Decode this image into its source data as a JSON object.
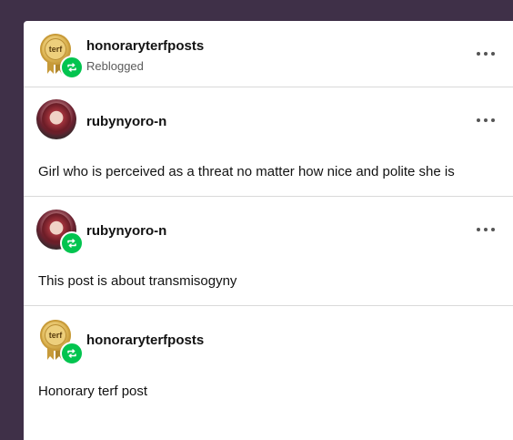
{
  "posts": [
    {
      "username": "honoraryterfposts",
      "subtitle": "Reblogged",
      "avatar_type": "seal",
      "seal_text": "terf",
      "reblog_badge": true,
      "more_icon": "ellipsis-icon"
    },
    {
      "username": "rubynyoro-n",
      "avatar_type": "photo",
      "reblog_badge": false,
      "more_icon": "ellipsis-icon",
      "body": "Girl who is perceived as a threat no matter how nice and polite she is"
    },
    {
      "username": "rubynyoro-n",
      "avatar_type": "photo",
      "reblog_badge": true,
      "more_icon": "ellipsis-icon",
      "body": "This post is about transmisogyny"
    },
    {
      "username": "honoraryterfposts",
      "avatar_type": "seal",
      "seal_text": "terf",
      "reblog_badge": true,
      "body": "Honorary terf post"
    }
  ],
  "colors": {
    "background": "#3f3048",
    "card": "#ffffff",
    "reblog_green": "#02c44f",
    "divider": "#d9d9d9"
  }
}
